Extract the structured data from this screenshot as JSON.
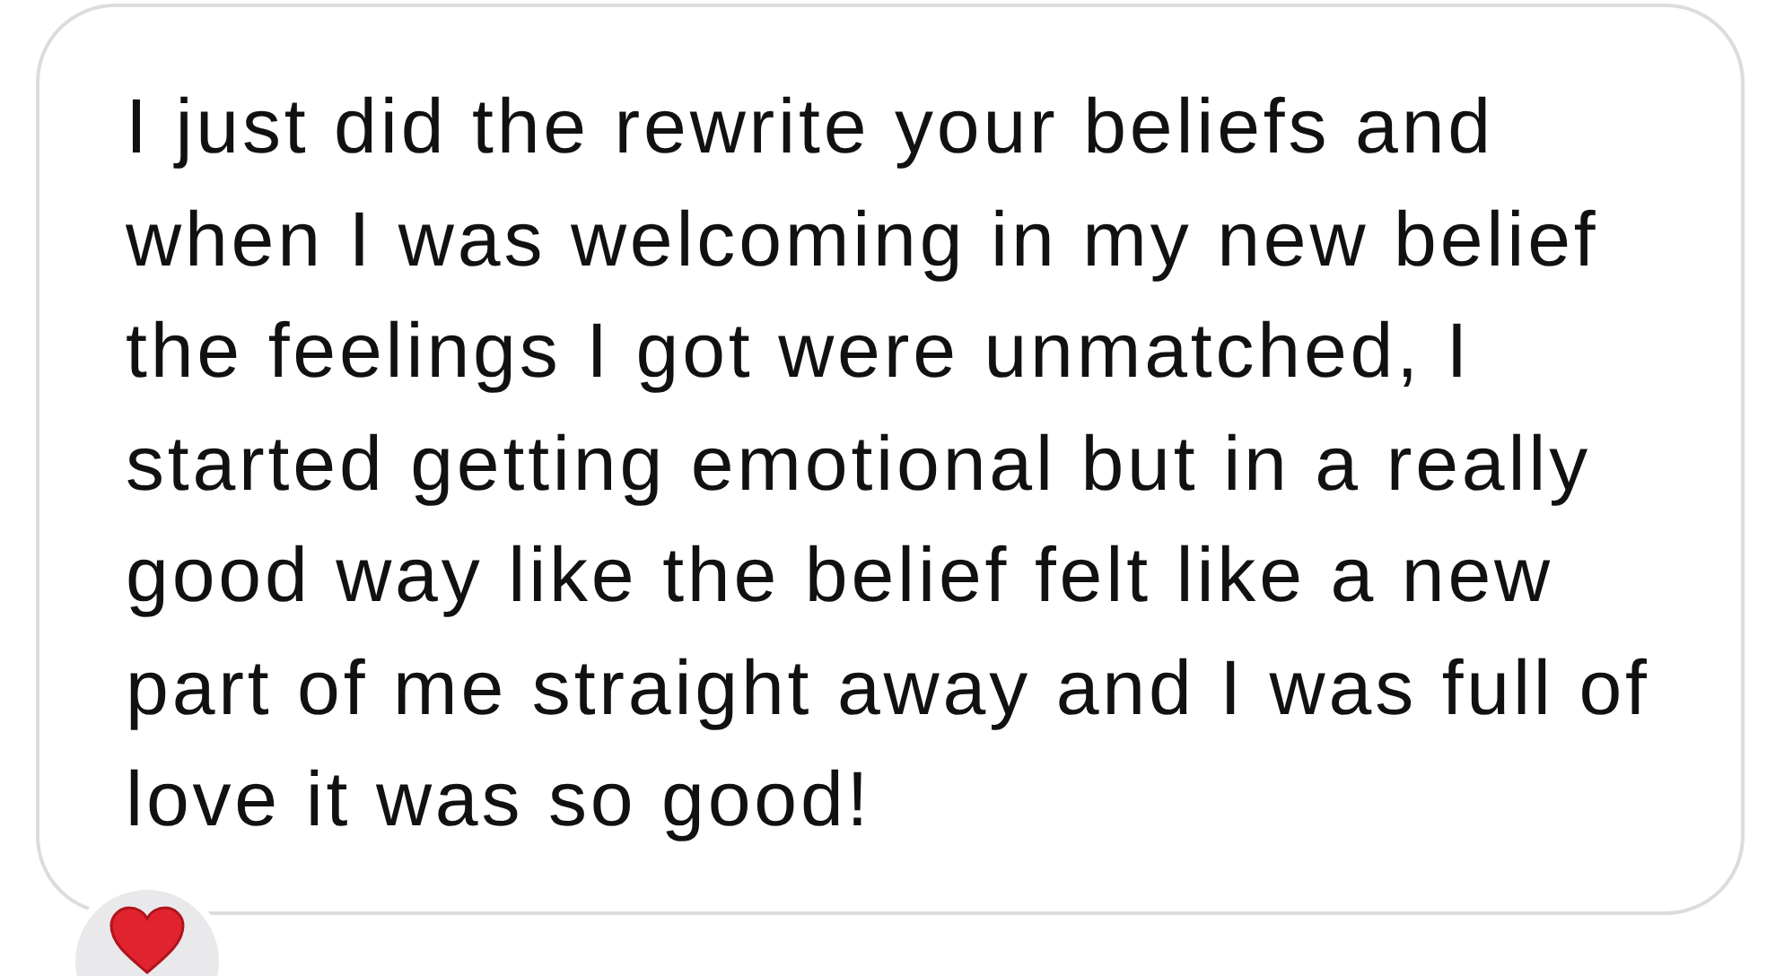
{
  "message": {
    "text": "I just did the rewrite your beliefs and when I was welcoming in my new belief the feelings I got were unmatched, I started getting emotional but in a really good way like the belief felt like a new part of me straight away and I was full of love it was so good!"
  }
}
